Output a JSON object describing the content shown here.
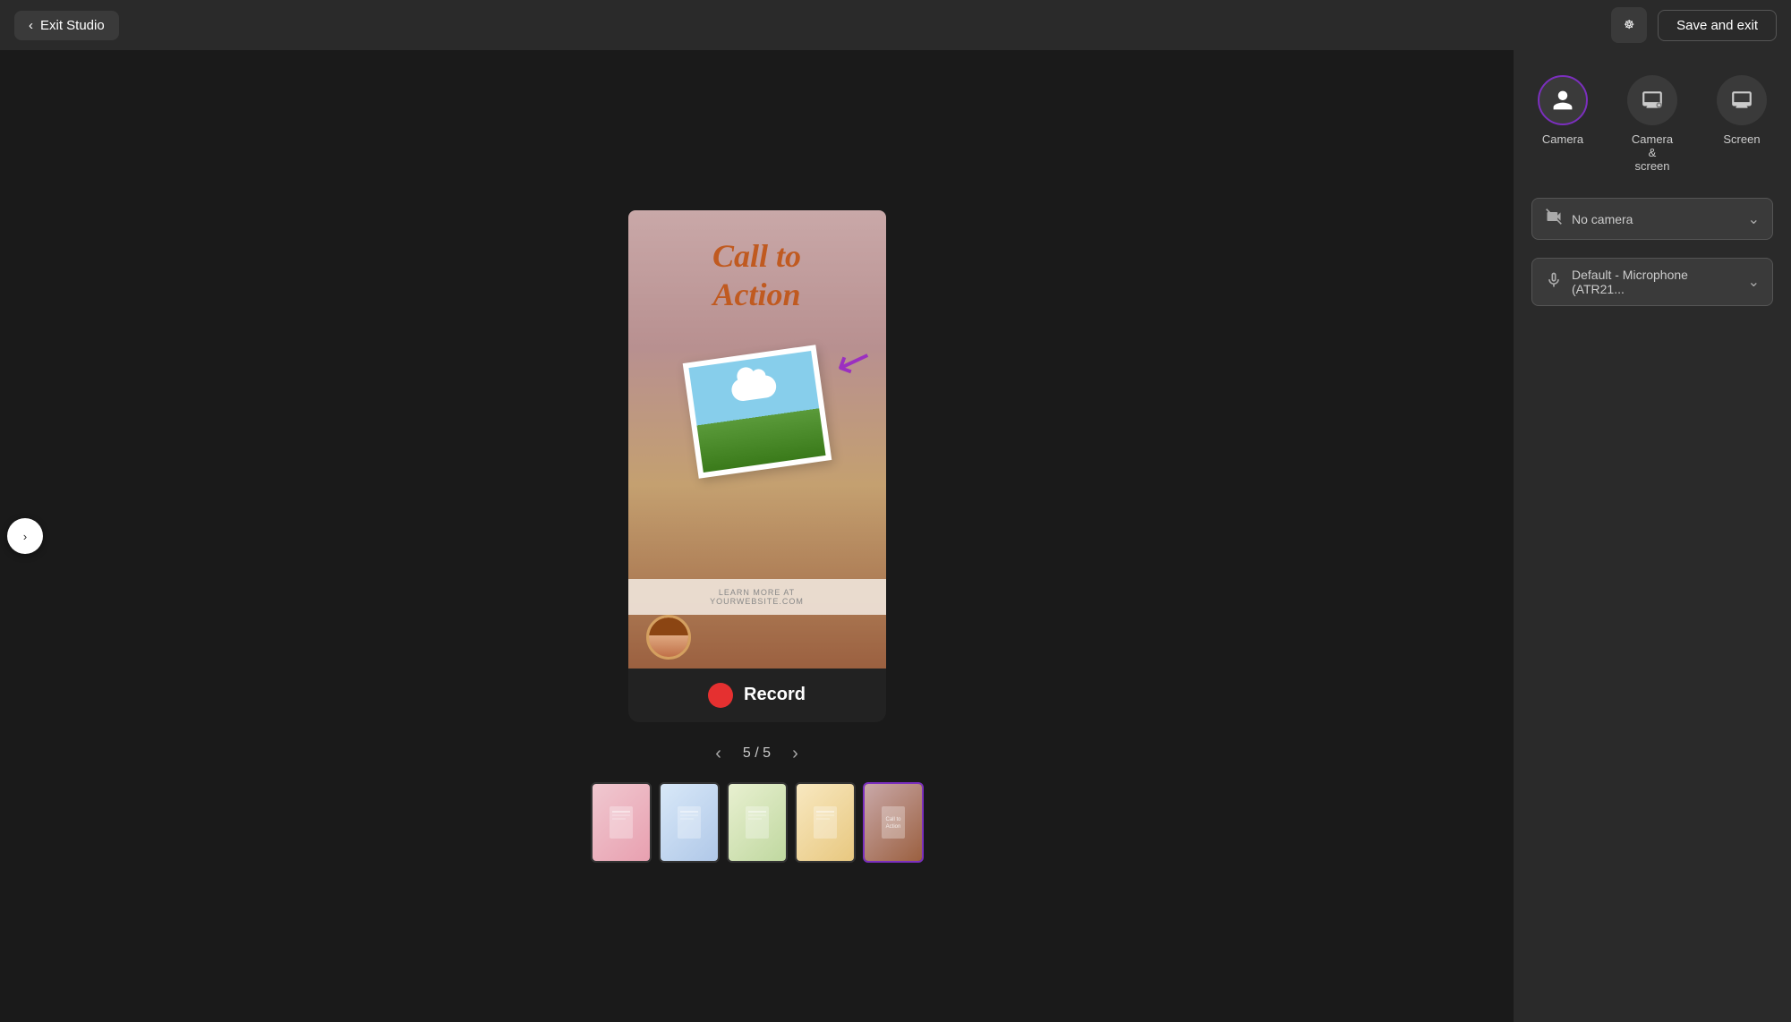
{
  "topbar": {
    "exit_label": "Exit Studio",
    "save_exit_label": "Save and exit"
  },
  "sidebar": {
    "toggle_icon": "chevron-right"
  },
  "slide": {
    "title_line1": "Call to",
    "title_line2": "Action",
    "footer_text1": "LEARN MORE AT",
    "footer_text2": "YOURWEBSITE.COM"
  },
  "record_bar": {
    "label": "Record"
  },
  "pagination": {
    "current": "5",
    "total": "5",
    "display": "5 / 5"
  },
  "right_panel": {
    "mode_tabs": [
      {
        "id": "camera",
        "label": "Camera",
        "icon": "👤",
        "active": true
      },
      {
        "id": "camera_screen",
        "label": "Camera &\nscreen",
        "icon": "📺",
        "active": false
      },
      {
        "id": "screen",
        "label": "Screen",
        "icon": "🖥",
        "active": false
      }
    ],
    "camera_dropdown": {
      "icon": "📷",
      "value": "No camera",
      "placeholder": "No camera"
    },
    "microphone_dropdown": {
      "icon": "🎤",
      "value": "Default - Microphone (ATR21...",
      "placeholder": "Default - Microphone (ATR21..."
    }
  },
  "thumbnails": [
    {
      "id": 1,
      "label": "Slide 1",
      "active": false
    },
    {
      "id": 2,
      "label": "Slide 2",
      "active": false
    },
    {
      "id": 3,
      "label": "Slide 3",
      "active": false
    },
    {
      "id": 4,
      "label": "Slide 4",
      "active": false
    },
    {
      "id": 5,
      "label": "Slide 5",
      "active": true
    }
  ]
}
